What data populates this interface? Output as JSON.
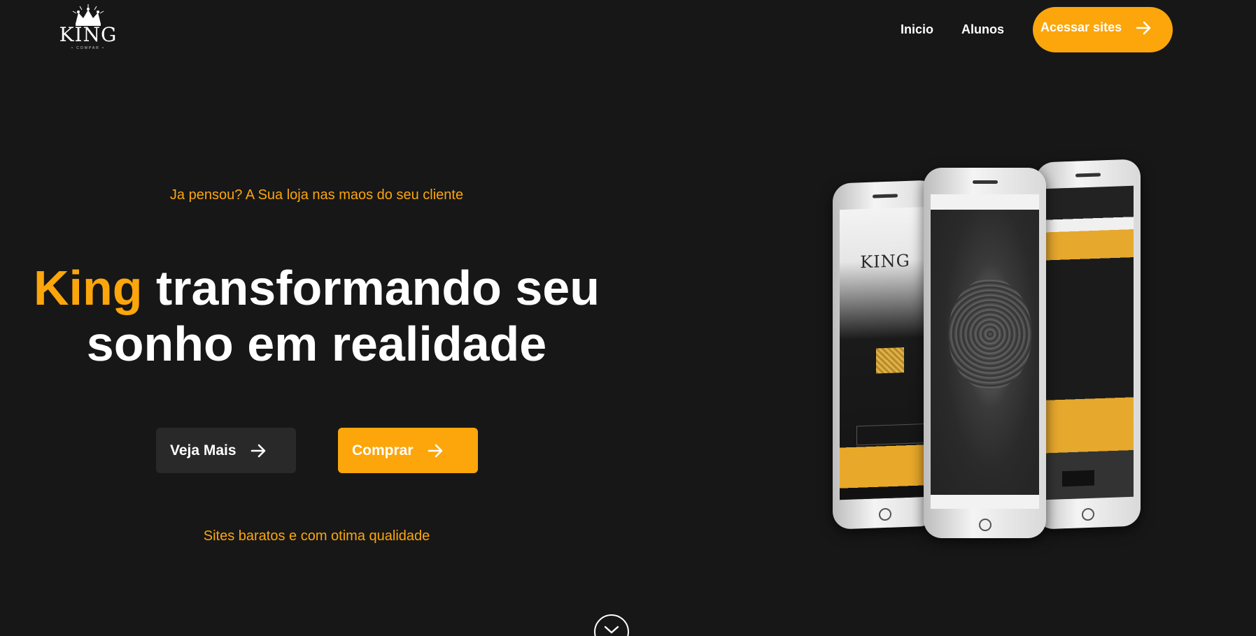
{
  "header": {
    "logo": {
      "word": "KING",
      "tagline": "• COMPAR •"
    },
    "nav": [
      {
        "label": "Inicio"
      },
      {
        "label": "Alunos"
      }
    ],
    "cta_label": "Acessar sites"
  },
  "hero": {
    "eyebrow": "Ja pensou? A Sua loja nas maos do seu cliente",
    "headline_brand": "King",
    "headline_rest_line1": " transformando seu",
    "headline_line2": "sonho em realidade",
    "buttons": {
      "secondary_label": "Veja Mais",
      "primary_label": "Comprar"
    },
    "tagline": "Sites baratos e com otima qualidade"
  },
  "mockup": {
    "left_phone_text": "KING"
  },
  "colors": {
    "background": "#171718",
    "accent": "#fca60b",
    "dark_button": "#292929",
    "text": "#ffffff"
  },
  "icons": {
    "arrow": "arrow-right-icon",
    "scroll": "chevron-down-icon",
    "crown": "crown-icon"
  }
}
